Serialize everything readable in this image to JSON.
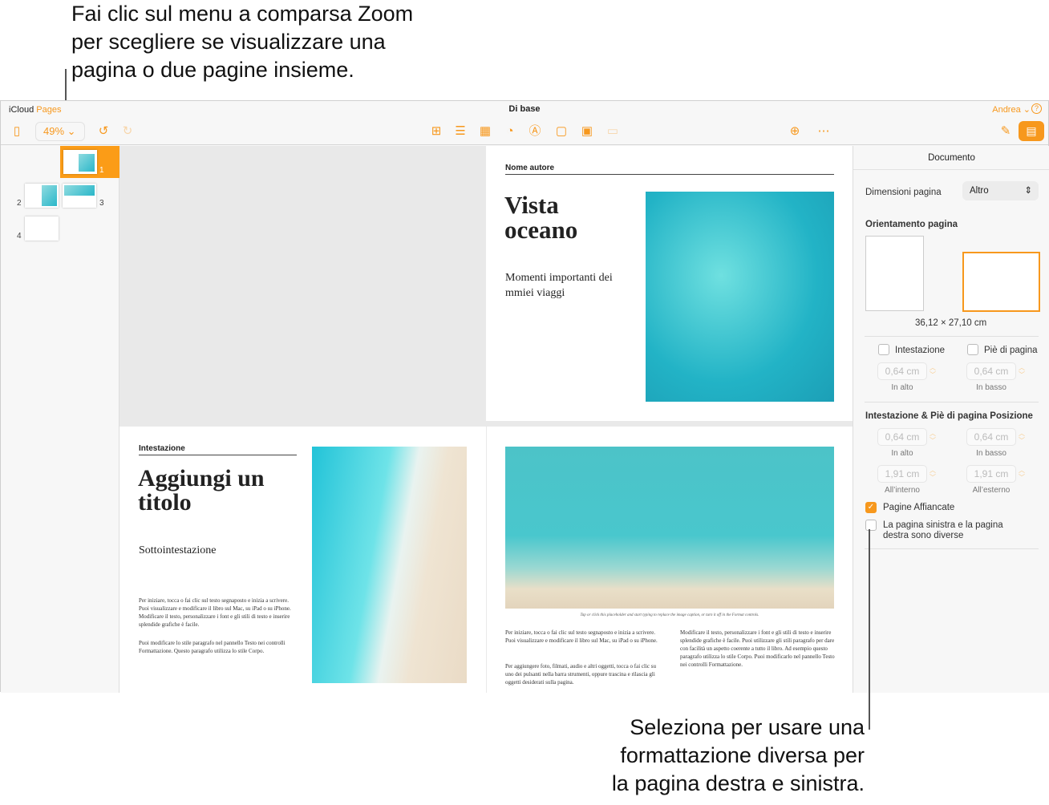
{
  "callouts": {
    "top": [
      "Fai clic sul menu a comparsa Zoom",
      "per scegliere se visualizzare una",
      "pagina o due pagine insieme."
    ],
    "bottom": [
      "Seleziona per usare una",
      "formattazione diversa per",
      "la pagina destra e sinistra."
    ]
  },
  "titlebar": {
    "brand_a": "iCloud",
    "brand_b": "Pages",
    "title": "Di base",
    "user": "Andrea",
    "help": "?"
  },
  "toolbar": {
    "zoom": "49%"
  },
  "thumbnails": [
    "1",
    "2",
    "3",
    "4"
  ],
  "page1": {
    "author": "Nome autore",
    "title1": "Vista",
    "title2": "oceano",
    "subtitle": "Momenti importanti dei mmiei viaggi"
  },
  "page2": {
    "header": "Intestazione",
    "title": "Aggiungi un titolo",
    "subheading": "Sottointestazione",
    "p1": "Per iniziare, tocca o fai clic sul testo segnaposto e inizia a scrivere. Puoi visualizzare e modificare il libro sul Mac, su iPad o su iPhone. Modificare il testo, personalizzare i font e gli stili di testo e inserire splendide grafiche è facile.",
    "p2": "Puoi modificare lo stile paragrafo nel pannello Testo nei controlli Formattazione. Questo paragrafo utilizza lo stile Corpo."
  },
  "page3": {
    "caption": "Tap or click this placeholder and start typing to replace the image caption, or turn it off in the Format controls.",
    "c1p1": "Per iniziare, tocca o fai clic sul testo segnaposto e inizia a scrivere. Puoi visualizzare e modificare il libro sul Mac, su iPad o su iPhone.",
    "c1p2": "Per aggiungere foto, filmati, audio e altri oggetti, tocca o fai clic su uno dei pulsanti nella barra strumenti, oppure trascina e rilascia gli oggetti desiderati sulla pagina.",
    "c2p1": "Modificare il testo, personalizzare i font e gli stili di testo e inserire splendide grafiche è facile. Puoi utilizzare gli stili paragrafo per dare con facilità un aspetto coerente a tutto il libro. Ad esempio questo paragrafo utilizza lo stile Corpo. Puoi modificarlo nel pannello Testo nei controlli Formattazione."
  },
  "panel": {
    "title": "Documento",
    "size_label": "Dimensioni pagina",
    "size_value": "Altro",
    "orient_label": "Orientamento pagina",
    "dims": "36,12 × 27,10 cm",
    "header_cb": "Intestazione",
    "footer_cb": "Piè di pagina",
    "v064": "0,64 cm",
    "v191": "1,91 cm",
    "top": "In alto",
    "bottom": "In basso",
    "pos_label": "Intestazione & Piè di pagina Posizione",
    "inside": "All’interno",
    "outside": "All’esterno",
    "facing": "Pagine Affiancate",
    "diff1": "La pagina sinistra e la pagina",
    "diff2": "destra sono diverse"
  }
}
